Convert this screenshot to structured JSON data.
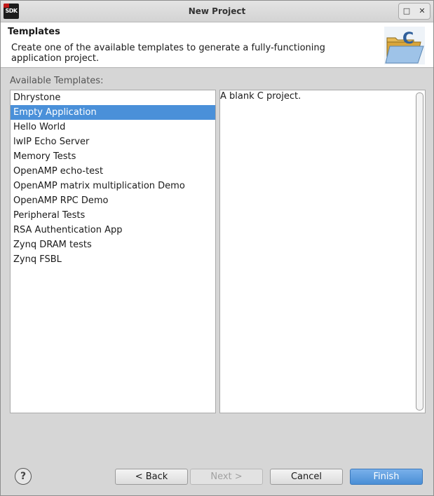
{
  "window": {
    "title": "New Project",
    "app_icon_label": "SDK",
    "icons": {
      "maximize": "maximize-icon",
      "close": "close-icon"
    }
  },
  "header": {
    "title": "Templates",
    "description": "Create one of the available templates to generate a fully-functioning application project.",
    "graphic_icon": "c-project-folder-icon"
  },
  "templates": {
    "label": "Available Templates:",
    "selected_index": 1,
    "items": [
      "Dhrystone",
      "Empty Application",
      "Hello World",
      "lwIP Echo Server",
      "Memory Tests",
      "OpenAMP echo-test",
      "OpenAMP matrix multiplication Demo",
      "OpenAMP RPC Demo",
      "Peripheral Tests",
      "RSA Authentication App",
      "Zynq DRAM tests",
      "Zynq FSBL"
    ]
  },
  "description_panel": {
    "text": "A blank C project."
  },
  "footer": {
    "help_icon": "help-icon",
    "back_label": "< Back",
    "next_label": "Next >",
    "cancel_label": "Cancel",
    "finish_label": "Finish"
  },
  "colors": {
    "selection": "#4a90d9",
    "primary_button": "#4a8fd6"
  }
}
